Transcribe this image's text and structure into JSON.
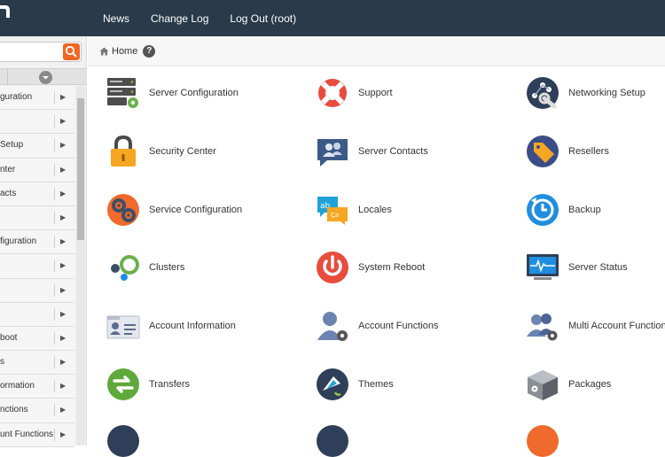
{
  "topnav": {
    "news": "News",
    "change_log": "Change Log",
    "logout": "Log Out (root)"
  },
  "sidebar": {
    "items": [
      {
        "label": "guration"
      },
      {
        "label": ""
      },
      {
        "label": "Setup"
      },
      {
        "label": "nter"
      },
      {
        "label": "acts"
      },
      {
        "label": ""
      },
      {
        "label": "figuration"
      },
      {
        "label": ""
      },
      {
        "label": ""
      },
      {
        "label": ""
      },
      {
        "label": "boot"
      },
      {
        "label": "s"
      },
      {
        "label": "ormation"
      },
      {
        "label": "nctions"
      },
      {
        "label": "unt Functions"
      }
    ]
  },
  "breadcrumb": {
    "home": "Home",
    "help": "?"
  },
  "grid": {
    "items": [
      {
        "label": "Server Configuration",
        "icon": "server-config-icon"
      },
      {
        "label": "Support",
        "icon": "lifebuoy-icon"
      },
      {
        "label": "Networking Setup",
        "icon": "network-icon"
      },
      {
        "label": "Security Center",
        "icon": "padlock-icon"
      },
      {
        "label": "Server Contacts",
        "icon": "contacts-icon"
      },
      {
        "label": "Resellers",
        "icon": "tag-icon"
      },
      {
        "label": "Service Configuration",
        "icon": "gears-icon"
      },
      {
        "label": "Locales",
        "icon": "locales-icon"
      },
      {
        "label": "Backup",
        "icon": "backup-icon"
      },
      {
        "label": "Clusters",
        "icon": "clusters-icon"
      },
      {
        "label": "System Reboot",
        "icon": "power-icon"
      },
      {
        "label": "Server Status",
        "icon": "monitor-icon"
      },
      {
        "label": "Account Information",
        "icon": "id-card-icon"
      },
      {
        "label": "Account Functions",
        "icon": "user-gear-icon"
      },
      {
        "label": "Multi Account Functions",
        "icon": "users-gear-icon"
      },
      {
        "label": "Transfers",
        "icon": "transfer-icon"
      },
      {
        "label": "Themes",
        "icon": "paint-icon"
      },
      {
        "label": "Packages",
        "icon": "package-icon"
      }
    ]
  },
  "colors": {
    "topbar": "#293a4a",
    "accent": "#f26522"
  }
}
